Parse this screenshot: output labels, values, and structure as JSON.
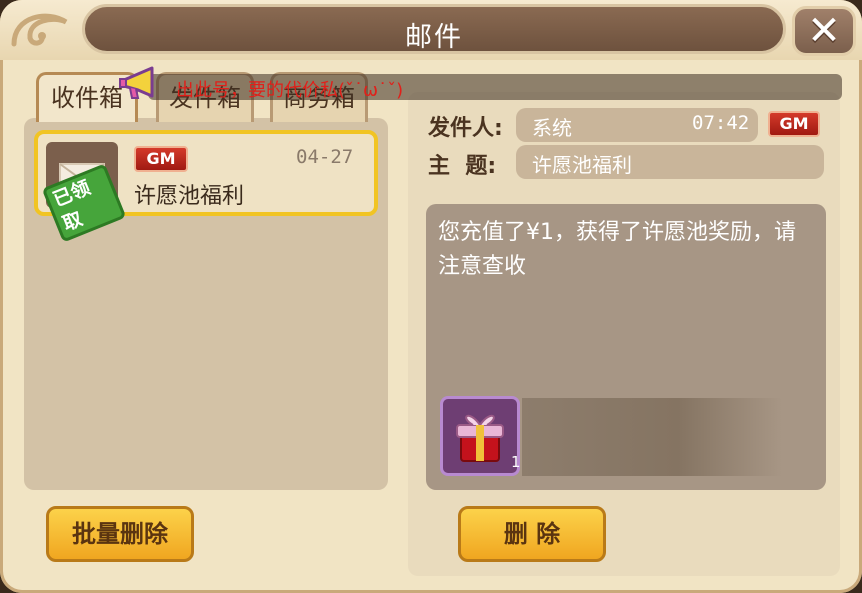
{
  "window": {
    "title": "邮件",
    "close_icon": "close-icon"
  },
  "tabs": [
    {
      "label": "收件箱",
      "active": true
    },
    {
      "label": "发件箱",
      "active": false
    },
    {
      "label": "商务箱",
      "active": false
    }
  ],
  "marquee": {
    "text": "出此号，要的代价私(ˇ˙ω˙ˇ)",
    "icon": "megaphone-icon",
    "color": "#e0201a"
  },
  "mail_list": [
    {
      "badge": "GM",
      "date": "04-27",
      "subject": "许愿池福利",
      "stamp": "已领取",
      "icon": "envelope-icon"
    }
  ],
  "detail": {
    "sender_label": "发件人:",
    "sender": "系统",
    "time": "07:42",
    "badge": "GM",
    "subject_label": "主  题:",
    "subject": "许愿池福利",
    "body": "您充值了¥1，获得了许愿池奖励，请注意查收",
    "attachment": {
      "icon": "gift-box-icon",
      "quantity": "1"
    }
  },
  "buttons": {
    "batch_delete": "批量删除",
    "delete": "删 除"
  },
  "colors": {
    "accent": "#f1c423",
    "badge_red": "#c22a1c",
    "button_gold": "#f7bc34"
  }
}
